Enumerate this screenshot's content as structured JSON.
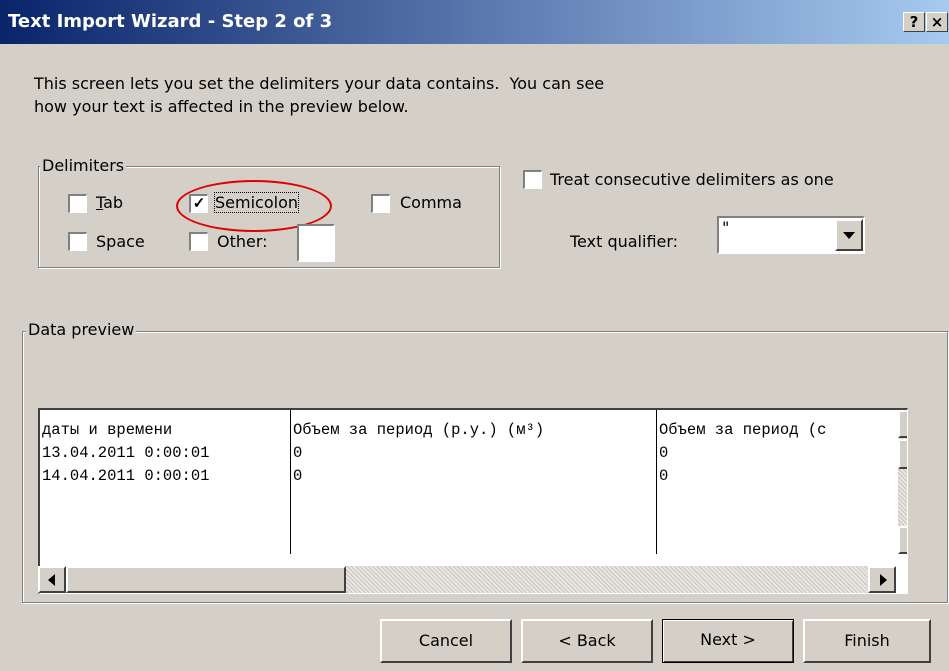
{
  "window": {
    "title": "Text Import Wizard - Step 2 of 3",
    "help_label": "?",
    "close_label": "×"
  },
  "intro": {
    "line1": "This screen lets you set the delimiters your data contains.  You can see",
    "line2": "how your text is affected in the preview below."
  },
  "delimiters": {
    "legend": "Delimiters",
    "tab": {
      "label": "Tab",
      "checked": false
    },
    "semicolon": {
      "label": "Semicolon",
      "checked": true
    },
    "comma": {
      "label": "Comma",
      "checked": false
    },
    "space": {
      "label": "Space",
      "checked": false
    },
    "other": {
      "label": "Other:",
      "checked": false,
      "value": ""
    }
  },
  "options": {
    "consecutive_label": "Treat consecutive delimiters as one",
    "consecutive_checked": false,
    "qualifier_label": "Text qualifier:",
    "qualifier_value": "\""
  },
  "preview": {
    "legend": "Data preview",
    "columns": [
      {
        "cells": [
          "даты и времени",
          "13.04.2011 0:00:01",
          "14.04.2011 0:00:01"
        ]
      },
      {
        "cells": [
          "Объем за период (р.у.) (м³)",
          "0",
          "0"
        ]
      },
      {
        "cells": [
          "Объем за период (с",
          "0",
          "0"
        ]
      }
    ]
  },
  "buttons": {
    "cancel": "Cancel",
    "back": "< Back",
    "next": "Next >",
    "finish": "Finish"
  },
  "colors": {
    "title_start": "#0a246a",
    "title_end": "#a6caf0",
    "dialog_bg": "#d4d0c8",
    "highlight_ellipse": "#e00000"
  }
}
